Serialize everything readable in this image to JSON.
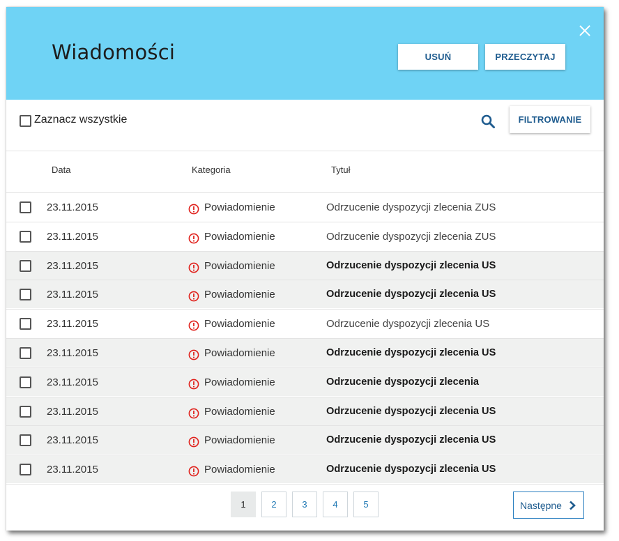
{
  "header": {
    "title": "Wiadomości",
    "delete_label": "USUŃ",
    "read_label": "PRZECZYTAJ",
    "close_icon": "close-icon"
  },
  "toolbar": {
    "select_all_label": "Zaznacz wszystkie",
    "filter_label": "FILTROWANIE",
    "search_icon": "search-icon"
  },
  "columns": [
    "Data",
    "Kategoria",
    "Tytuł"
  ],
  "rows": [
    {
      "date": "23.11.2015",
      "category": "Powiadomienie",
      "title": "Odrzucenie dyspozycji zlecenia ZUS",
      "unread": false
    },
    {
      "date": "23.11.2015",
      "category": "Powiadomienie",
      "title": "Odrzucenie dyspozycji zlecenia ZUS",
      "unread": false
    },
    {
      "date": "23.11.2015",
      "category": "Powiadomienie",
      "title": "Odrzucenie dyspozycji zlecenia US",
      "unread": true
    },
    {
      "date": "23.11.2015",
      "category": "Powiadomienie",
      "title": "Odrzucenie dyspozycji zlecenia US",
      "unread": true
    },
    {
      "date": "23.11.2015",
      "category": "Powiadomienie",
      "title": "Odrzucenie dyspozycji zlecenia US",
      "unread": false
    },
    {
      "date": "23.11.2015",
      "category": "Powiadomienie",
      "title": "Odrzucenie dyspozycji zlecenia US",
      "unread": true
    },
    {
      "date": "23.11.2015",
      "category": "Powiadomienie",
      "title": "Odrzucenie dyspozycji zlecenia",
      "unread": true
    },
    {
      "date": "23.11.2015",
      "category": "Powiadomienie",
      "title": "Odrzucenie dyspozycji zlecenia US",
      "unread": true
    },
    {
      "date": "23.11.2015",
      "category": "Powiadomienie",
      "title": "Odrzucenie dyspozycji zlecenia US",
      "unread": true
    },
    {
      "date": "23.11.2015",
      "category": "Powiadomienie",
      "title": "Odrzucenie dyspozycji zlecenia US",
      "unread": true
    }
  ],
  "pagination": {
    "pages": [
      "1",
      "2",
      "3",
      "4",
      "5"
    ],
    "active_page": "1",
    "next_label": "Następne"
  },
  "colors": {
    "header_bg": "#6fd3f5",
    "accent": "#1f5c8f",
    "alert": "#e0201b",
    "row_shaded": "#f0f1f0"
  }
}
